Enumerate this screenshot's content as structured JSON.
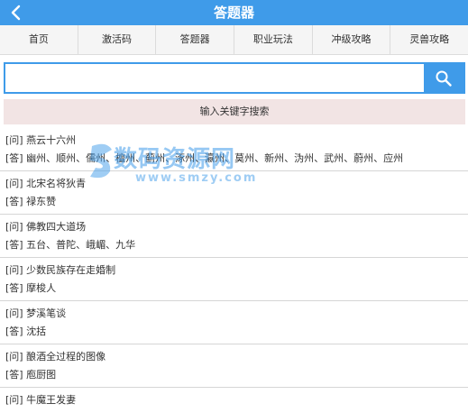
{
  "header": {
    "title": "答题器",
    "back_icon": "chevron-left-icon"
  },
  "tabs": [
    {
      "label": "首页"
    },
    {
      "label": "激活码"
    },
    {
      "label": "答题器"
    },
    {
      "label": "职业玩法"
    },
    {
      "label": "冲级攻略"
    },
    {
      "label": "灵兽攻略"
    }
  ],
  "search": {
    "placeholder": "",
    "value": "",
    "button_icon": "search-icon"
  },
  "hint": {
    "text": "输入关键字搜索"
  },
  "qa_items": [
    {
      "question": "[问] 燕云十六州",
      "answer": "[答] 幽州、顺州、儒州、檀州、蓟州、涿州、瀛州、莫州、新州、沩州、武州、蔚州、应州"
    },
    {
      "question": "[问] 北宋名将狄青",
      "answer": "[答] 禄东赞"
    },
    {
      "question": "[问] 佛教四大道场",
      "answer": "[答] 五台、普陀、峨嵋、九华"
    },
    {
      "question": "[问] 少数民族存在走婚制",
      "answer": "[答] 摩梭人"
    },
    {
      "question": "[问] 梦溪笔谈",
      "answer": "[答] 沈括"
    },
    {
      "question": "[问] 酿酒全过程的图像",
      "answer": "[答] 庖厨图"
    },
    {
      "question": "[问] 牛魔王发妻",
      "answer": ""
    }
  ],
  "watermark": {
    "text": "数码资源网",
    "url": "www.smzy.com"
  },
  "colors": {
    "accent": "#3f9be9",
    "hint_bg": "#f2e4e4",
    "tab_bg": "#f5f5f5"
  }
}
